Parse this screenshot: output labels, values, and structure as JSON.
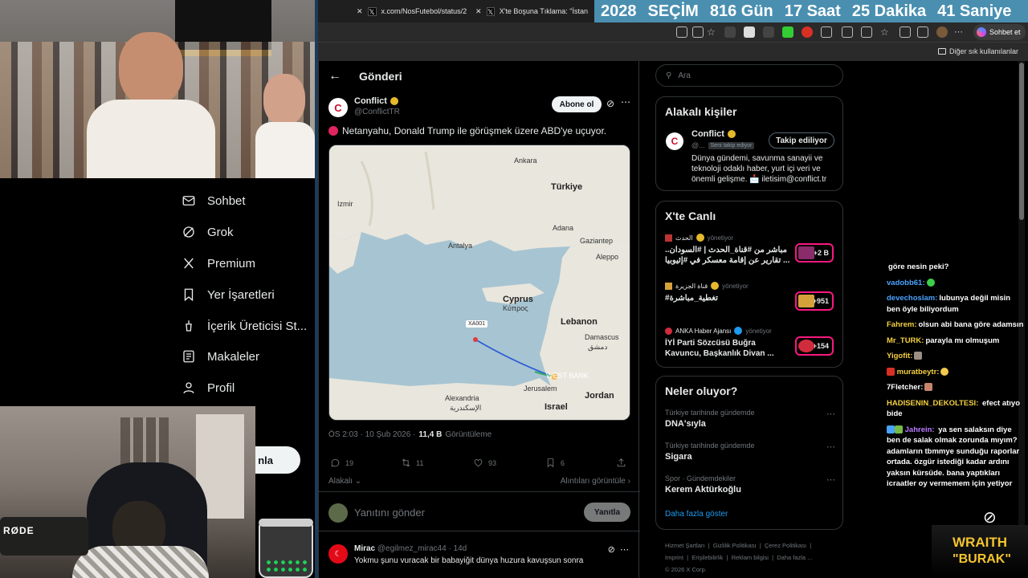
{
  "browser": {
    "tabs": [
      {
        "label": "x.com/NosFutebol/status/2"
      },
      {
        "label": "X'te Boşuna Tıklama: \"İstan"
      }
    ],
    "countdown": [
      "2028",
      "SEÇİM",
      "816 Gün",
      "17 Saat",
      "25 Dakika",
      "41 Saniye"
    ],
    "sohbet_label": "Sohbet et",
    "bookmark_folder": "Diğer sık kullanılanlar"
  },
  "nav": {
    "items": [
      {
        "label": "Sohbet",
        "icon": "mail-icon"
      },
      {
        "label": "Grok",
        "icon": "grok-icon"
      },
      {
        "label": "Premium",
        "icon": "x-logo-icon"
      },
      {
        "label": "Yer İşaretleri",
        "icon": "bookmark-icon"
      },
      {
        "label": "İçerik Üreticisi St...",
        "icon": "creator-icon"
      },
      {
        "label": "Makaleler",
        "icon": "article-icon"
      },
      {
        "label": "Profil",
        "icon": "person-icon"
      }
    ],
    "post_button": "nla"
  },
  "cam": {
    "mic_brand": "RØDE"
  },
  "post": {
    "header": "Gönderi",
    "author_name": "Conflict",
    "author_handle": "@ConflictTR",
    "follow_label": "Abone ol",
    "text": "Netanyahu, Donald Trump ile görüşmek üzere ABD'ye uçuyor.",
    "time": "ÖS 2:03 · 10 Şub 2026 ·",
    "views": "11,4 B",
    "views_label": "Görüntüleme",
    "replies": "19",
    "reposts": "11",
    "likes": "93",
    "bookmarks": "6",
    "sort_left": "Alakalı",
    "sort_right": "Alıntıları görüntüle",
    "reply_placeholder": "Yanıtını gönder",
    "reply_button": "Yanıtla",
    "map": {
      "labels": [
        "Türkiye",
        "Ankara",
        "Izmir",
        "Antalya",
        "Adana",
        "Gaziantep",
        "Aleppo",
        "Cyprus",
        "Κύπρος",
        "Lebanon",
        "Damascus",
        "دمشق",
        "WEST BANK",
        "Jerusalem",
        "Jordan",
        "Israel",
        "Alexandria",
        "الإسكندرية"
      ],
      "callsign": "XA001"
    }
  },
  "first_reply": {
    "name": "Mirac",
    "handle": "@egilmez_mirac44 · 14d",
    "text": "Yokmu şunu vuracak bir babayiğit dünya huzura kavuşsun sonra"
  },
  "sidebar": {
    "search_placeholder": "Ara",
    "related": {
      "title": "Alakalı kişiler",
      "name": "Conflict",
      "handle": "@...",
      "badge": "Seni takip ediyor",
      "button": "Takip ediliyor",
      "bio": "Dünya gündemi, savunma sanayii ve teknoloji odaklı haber, yurt içi veri ve önemli gelişme. 📩 iletisim@conflict.tr"
    },
    "live": {
      "title": "X'te Canlı",
      "items": [
        {
          "source": "الحدث",
          "host": "yönetiyor",
          "title": "مباشر من #قناة_الحدث | #السودان.. تقارير عن إقامة معسكر في #إثيوبيا ...",
          "count": "+2 B"
        },
        {
          "source": "قناة الجزيرة",
          "host": "yönetiyor",
          "title": "#تغطية_مباشرة",
          "count": "+951"
        },
        {
          "source": "ANKA Haber Ajansı",
          "host": "yönetiyor",
          "title": "İYİ Parti Sözcüsü Buğra Kavuncu, Başkanlık Divan ...",
          "count": "+154"
        }
      ]
    },
    "trends": {
      "title": "Neler oluyor?",
      "items": [
        {
          "context": "Türkiye tarihinde gündemde",
          "name": "DNA'sıyla"
        },
        {
          "context": "Türkiye tarihinde gündemde",
          "name": "Sigara"
        },
        {
          "context": "Spor · Gündemdekiler",
          "name": "Kerem Aktürkoğlu"
        }
      ],
      "show_more": "Daha fazla göster"
    },
    "footer": [
      "Hizmet Şartları",
      "Gizlilik Politikası",
      "Çerez Politikası",
      "Imprint",
      "Erişilebilirlik",
      "Reklam bilgisi",
      "Daha fazla ...",
      "© 2026 X Corp."
    ]
  },
  "chat": {
    "messages": [
      {
        "user": "",
        "user_color": "#ffffff",
        "text": "göre nesin peki?"
      },
      {
        "user": "vadobb61:",
        "user_color": "#4aa3ff",
        "text": ""
      },
      {
        "user": "devechoslam:",
        "user_color": "#4aa3ff",
        "text": "lubunya değil misin ben öyle biliyordum"
      },
      {
        "user": "Fahrem:",
        "user_color": "#f4d03f",
        "text": "olsun abi bana göre adamsın"
      },
      {
        "user": "Mr_TURK:",
        "user_color": "#f4d03f",
        "text": "parayla mı olmuşum"
      },
      {
        "user": "Yigofit:",
        "user_color": "#f4d03f",
        "text": ""
      },
      {
        "user": "muratbeytr:",
        "user_color": "#f4d03f",
        "text": ""
      },
      {
        "user": "7Fletcher:",
        "user_color": "#ffffff",
        "text": ""
      },
      {
        "user": "HADISENIN_DEKOLTESI:",
        "user_color": "#f4d03f",
        "text": "efect atıyo bide"
      },
      {
        "user": "Jahrein:",
        "user_color": "#b97bff",
        "text": "ya sen salaksın diye ben de salak olmak zorunda mıyım? adamların tbmmye sunduğu raporlar ortada. özgür istediği kadar ardını yaksın kürsüde. bana yaptıkları icraatler oy vermemem için yetiyor"
      }
    ]
  },
  "brand": {
    "line1": "WRAITH",
    "line2": "\"BURAK\""
  }
}
